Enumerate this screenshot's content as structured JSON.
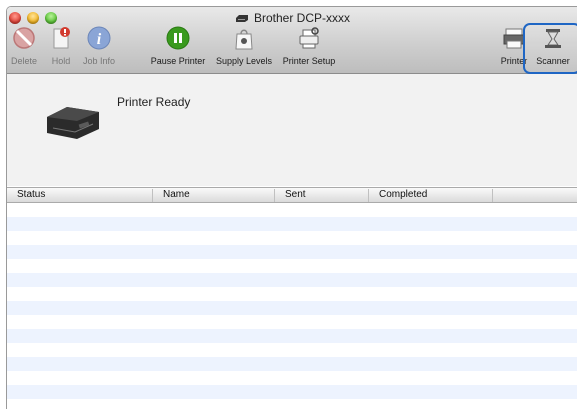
{
  "window": {
    "title": "Brother DCP-xxxx"
  },
  "toolbar": {
    "delete": "Delete",
    "hold": "Hold",
    "job_info": "Job Info",
    "pause_printer": "Pause Printer",
    "supply_levels": "Supply Levels",
    "printer_setup": "Printer Setup",
    "printer": "Printer",
    "scanner": "Scanner"
  },
  "printer_status": "Printer Ready",
  "table": {
    "columns": [
      "Status",
      "Name",
      "Sent",
      "Completed"
    ],
    "rows": []
  },
  "colors": {
    "selection": "#1f66c4",
    "row_alt": "#edf3fe",
    "pause_green": "#3a9a1e"
  },
  "icons": [
    "printer-icon",
    "delete-icon",
    "hold-icon",
    "info-icon",
    "pause-icon",
    "supply-levels-icon",
    "printer-setup-icon",
    "scanner-icon"
  ]
}
